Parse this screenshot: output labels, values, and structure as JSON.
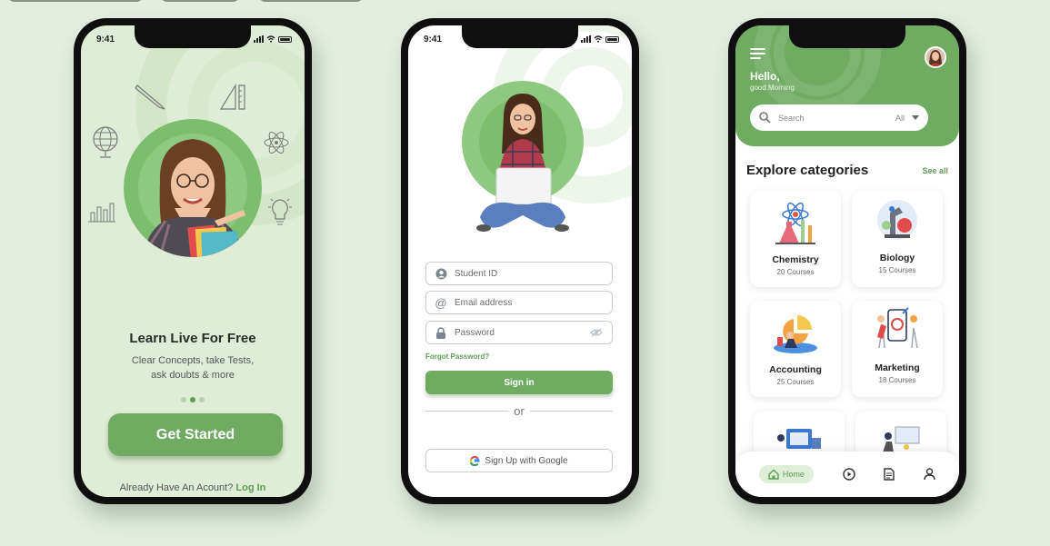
{
  "phone1": {
    "status_time": "9:41",
    "title": "Learn Live For Free",
    "subtitle_line1": "Clear Concepts, take Tests,",
    "subtitle_line2": "ask doubts & more",
    "cta_label": "Get Started",
    "footer_text": "Already Have An Acount?",
    "footer_link": "Log In",
    "pagination": {
      "count": 3,
      "active": 2
    }
  },
  "phone2": {
    "status_time": "9:41",
    "student_id_placeholder": "Student ID",
    "email_placeholder": "Email address",
    "password_placeholder": "Password",
    "forgot_label": "Forgot Password?",
    "signin_label": "Sign in",
    "or_label": "or",
    "google_label": "Sign Up with Google"
  },
  "phone3": {
    "greeting": "Hello,",
    "greeting_sub": "good Morning",
    "search_placeholder": "Search",
    "search_filter": "All",
    "section_title": "Explore categories",
    "see_all": "See all",
    "categories": [
      {
        "name": "Chemistry",
        "count": "20 Courses",
        "icon": "chemistry-illustration"
      },
      {
        "name": "Biology",
        "count": "15 Courses",
        "icon": "biology-illustration"
      },
      {
        "name": "Accounting",
        "count": "25 Courses",
        "icon": "accounting-illustration"
      },
      {
        "name": "Marketing",
        "count": "18 Courses",
        "icon": "marketing-illustration"
      }
    ],
    "nav": {
      "home_label": "Home"
    }
  },
  "colors": {
    "accent": "#6fac62",
    "background": "#e3ede0",
    "accent_light": "#deeed7"
  }
}
